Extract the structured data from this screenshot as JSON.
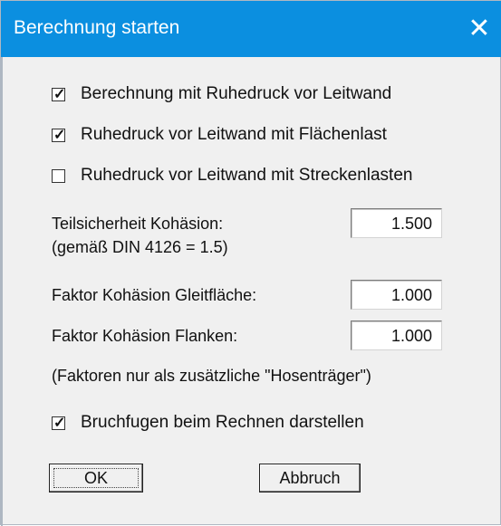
{
  "dialog": {
    "title": "Berechnung starten",
    "close_symbol": "✕"
  },
  "options": [
    {
      "label": "Berechnung mit Ruhedruck vor Leitwand",
      "checked": true
    },
    {
      "label": "Ruhedruck vor Leitwand mit Flächenlast",
      "checked": true
    },
    {
      "label": "Ruhedruck vor Leitwand mit Streckenlasten",
      "checked": false
    }
  ],
  "partial_safety": {
    "label": "Teilsicherheit Kohäsion:",
    "note": "(gemäß DIN 4126 = 1.5)",
    "value": "1.500"
  },
  "factor_slip": {
    "label": "Faktor Kohäsion Gleitfläche:",
    "value": "1.000"
  },
  "factor_flanks": {
    "label": "Faktor Kohäsion Flanken:",
    "value": "1.000"
  },
  "factors_note": "(Faktoren nur als zusätzliche \"Hosenträger\")",
  "show_fractures": {
    "label": "Bruchfugen beim Rechnen darstellen",
    "checked": true
  },
  "buttons": {
    "ok": "OK",
    "cancel": "Abbruch"
  },
  "colors": {
    "titlebar": "#0b8fe0",
    "dialog_bg": "#f0f0f0"
  }
}
